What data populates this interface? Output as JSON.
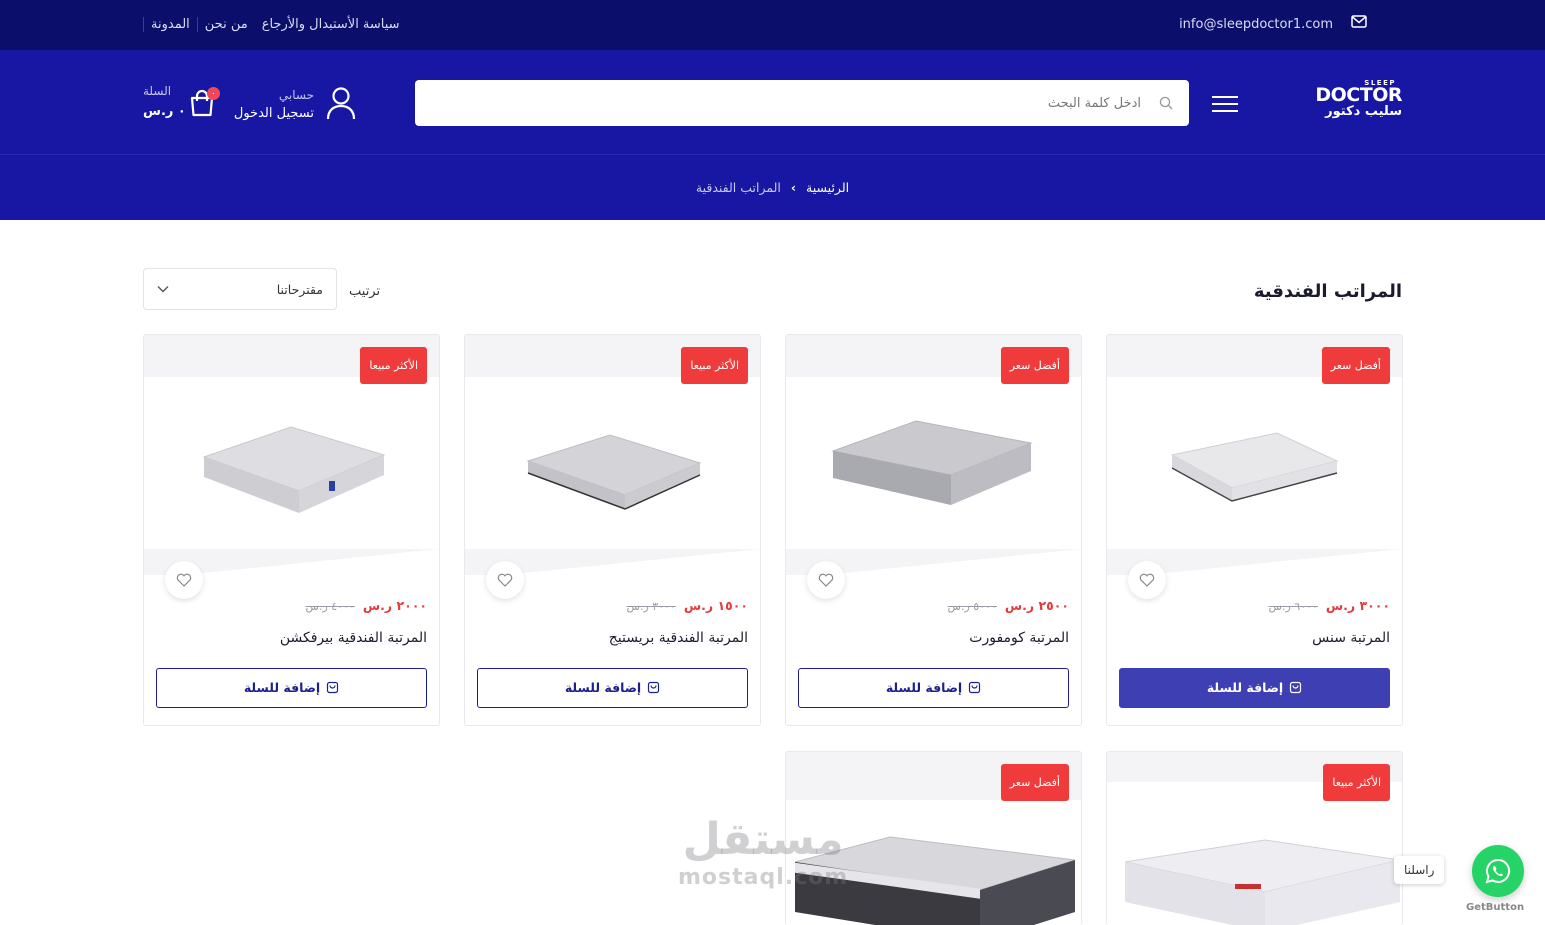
{
  "topbar": {
    "email": "info@sleepdoctor1.com",
    "links": [
      "المدونة",
      "من نحن",
      "سياسة الأستبدال والأرجاع"
    ]
  },
  "header": {
    "logo_en": "DOCTOR",
    "logo_sleep": "SLEEP",
    "logo_ar": "سليب دكتور",
    "search_placeholder": "ادخل كلمة البحث",
    "account_label": "حسابي",
    "login_label": "تسجيل الدخول",
    "cart_label": "السلة",
    "cart_total": "٠ ر.س",
    "cart_count": "٠"
  },
  "breadcrumb": {
    "home": "الرئيسية",
    "sep": "›",
    "current": "المراتب الفندقية"
  },
  "listing": {
    "title": "المراتب الفندقية",
    "sort_label": "ترتيب",
    "sort_value": "مقترحاتنا"
  },
  "products": [
    {
      "tag": "أفضل سعر",
      "price": "٣٠٠٠ ر.س",
      "old_price": "٦٠٠٠ ر.س",
      "name": "المرتبة سنس",
      "button": "إضافة للسلة"
    },
    {
      "tag": "أفضل سعر",
      "price": "٢٥٠٠ ر.س",
      "old_price": "٥٠٠٠ ر.س",
      "name": "المرتبة كومفورت",
      "button": "إضافة للسلة"
    },
    {
      "tag": "الأكثر مبيعا",
      "price": "١٥٠٠ ر.س",
      "old_price": "٣٠٠٠ ر.س",
      "name": "المرتبة الفندقية بريستيج",
      "button": "إضافة للسلة"
    },
    {
      "tag": "الأكثر مبيعا",
      "price": "٢٠٠٠ ر.س",
      "old_price": "٤٠٠٠ ر.س",
      "name": "المرتبة الفندقية بيرفكشن",
      "button": "إضافة للسلة"
    },
    {
      "tag": "الأكثر مبيعا"
    },
    {
      "tag": "أفضل سعر"
    }
  ],
  "watermark": {
    "ar": "مستقل",
    "en": "mostaql.com"
  },
  "whatsapp": {
    "tooltip": "راسلنا",
    "credit": "GetButton"
  },
  "colors": {
    "topbar": "#0b0f6b",
    "header": "#1717a3",
    "tag": "#ef3b3b",
    "price": "#e23b3b",
    "button_active": "#3e3fb2"
  }
}
